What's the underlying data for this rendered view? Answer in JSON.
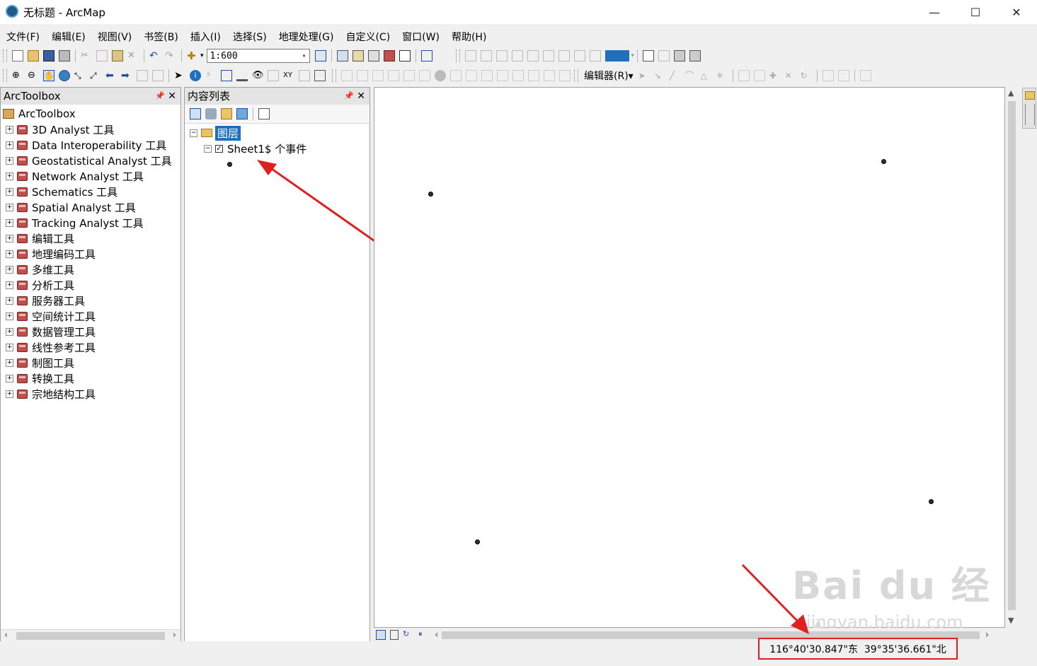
{
  "window": {
    "title": "无标题 - ArcMap",
    "minimize": "—",
    "maximize": "☐",
    "close": "✕"
  },
  "menu": [
    "文件(F)",
    "编辑(E)",
    "视图(V)",
    "书签(B)",
    "插入(I)",
    "选择(S)",
    "地理处理(G)",
    "自定义(C)",
    "窗口(W)",
    "帮助(H)"
  ],
  "toolbar": {
    "scale_value": "1:600",
    "editor_label": "编辑器(R)▾"
  },
  "toolbox_panel": {
    "title": "ArcToolbox",
    "root": "ArcToolbox",
    "items": [
      "3D Analyst 工具",
      "Data Interoperability 工具",
      "Geostatistical Analyst 工具",
      "Network Analyst 工具",
      "Schematics 工具",
      "Spatial Analyst 工具",
      "Tracking Analyst 工具",
      "编辑工具",
      "地理编码工具",
      "多维工具",
      "分析工具",
      "服务器工具",
      "空间统计工具",
      "数据管理工具",
      "线性参考工具",
      "制图工具",
      "转换工具",
      "宗地结构工具"
    ]
  },
  "toc_panel": {
    "title": "内容列表",
    "layers_label": "图层",
    "layer_name": "Sheet1$ 个事件"
  },
  "status": {
    "coordinates": "116°40'30.847\"东  39°35'36.661\"北"
  },
  "watermark": {
    "brand": "Bai du 经验",
    "url": "jingyan.baidu.com"
  },
  "colors": {
    "annotation_red": "#e02020",
    "point_fill": "#1e3b1e",
    "layers_highlight": "#1f6fbf"
  }
}
